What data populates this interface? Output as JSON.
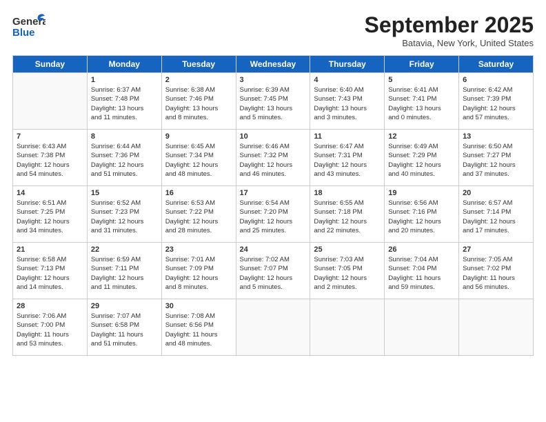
{
  "header": {
    "logo_general": "General",
    "logo_blue": "Blue",
    "title": "September 2025",
    "location": "Batavia, New York, United States"
  },
  "days_of_week": [
    "Sunday",
    "Monday",
    "Tuesday",
    "Wednesday",
    "Thursday",
    "Friday",
    "Saturday"
  ],
  "weeks": [
    [
      {
        "day": "",
        "info": ""
      },
      {
        "day": "1",
        "info": "Sunrise: 6:37 AM\nSunset: 7:48 PM\nDaylight: 13 hours\nand 11 minutes."
      },
      {
        "day": "2",
        "info": "Sunrise: 6:38 AM\nSunset: 7:46 PM\nDaylight: 13 hours\nand 8 minutes."
      },
      {
        "day": "3",
        "info": "Sunrise: 6:39 AM\nSunset: 7:45 PM\nDaylight: 13 hours\nand 5 minutes."
      },
      {
        "day": "4",
        "info": "Sunrise: 6:40 AM\nSunset: 7:43 PM\nDaylight: 13 hours\nand 3 minutes."
      },
      {
        "day": "5",
        "info": "Sunrise: 6:41 AM\nSunset: 7:41 PM\nDaylight: 13 hours\nand 0 minutes."
      },
      {
        "day": "6",
        "info": "Sunrise: 6:42 AM\nSunset: 7:39 PM\nDaylight: 12 hours\nand 57 minutes."
      }
    ],
    [
      {
        "day": "7",
        "info": "Sunrise: 6:43 AM\nSunset: 7:38 PM\nDaylight: 12 hours\nand 54 minutes."
      },
      {
        "day": "8",
        "info": "Sunrise: 6:44 AM\nSunset: 7:36 PM\nDaylight: 12 hours\nand 51 minutes."
      },
      {
        "day": "9",
        "info": "Sunrise: 6:45 AM\nSunset: 7:34 PM\nDaylight: 12 hours\nand 48 minutes."
      },
      {
        "day": "10",
        "info": "Sunrise: 6:46 AM\nSunset: 7:32 PM\nDaylight: 12 hours\nand 46 minutes."
      },
      {
        "day": "11",
        "info": "Sunrise: 6:47 AM\nSunset: 7:31 PM\nDaylight: 12 hours\nand 43 minutes."
      },
      {
        "day": "12",
        "info": "Sunrise: 6:49 AM\nSunset: 7:29 PM\nDaylight: 12 hours\nand 40 minutes."
      },
      {
        "day": "13",
        "info": "Sunrise: 6:50 AM\nSunset: 7:27 PM\nDaylight: 12 hours\nand 37 minutes."
      }
    ],
    [
      {
        "day": "14",
        "info": "Sunrise: 6:51 AM\nSunset: 7:25 PM\nDaylight: 12 hours\nand 34 minutes."
      },
      {
        "day": "15",
        "info": "Sunrise: 6:52 AM\nSunset: 7:23 PM\nDaylight: 12 hours\nand 31 minutes."
      },
      {
        "day": "16",
        "info": "Sunrise: 6:53 AM\nSunset: 7:22 PM\nDaylight: 12 hours\nand 28 minutes."
      },
      {
        "day": "17",
        "info": "Sunrise: 6:54 AM\nSunset: 7:20 PM\nDaylight: 12 hours\nand 25 minutes."
      },
      {
        "day": "18",
        "info": "Sunrise: 6:55 AM\nSunset: 7:18 PM\nDaylight: 12 hours\nand 22 minutes."
      },
      {
        "day": "19",
        "info": "Sunrise: 6:56 AM\nSunset: 7:16 PM\nDaylight: 12 hours\nand 20 minutes."
      },
      {
        "day": "20",
        "info": "Sunrise: 6:57 AM\nSunset: 7:14 PM\nDaylight: 12 hours\nand 17 minutes."
      }
    ],
    [
      {
        "day": "21",
        "info": "Sunrise: 6:58 AM\nSunset: 7:13 PM\nDaylight: 12 hours\nand 14 minutes."
      },
      {
        "day": "22",
        "info": "Sunrise: 6:59 AM\nSunset: 7:11 PM\nDaylight: 12 hours\nand 11 minutes."
      },
      {
        "day": "23",
        "info": "Sunrise: 7:01 AM\nSunset: 7:09 PM\nDaylight: 12 hours\nand 8 minutes."
      },
      {
        "day": "24",
        "info": "Sunrise: 7:02 AM\nSunset: 7:07 PM\nDaylight: 12 hours\nand 5 minutes."
      },
      {
        "day": "25",
        "info": "Sunrise: 7:03 AM\nSunset: 7:05 PM\nDaylight: 12 hours\nand 2 minutes."
      },
      {
        "day": "26",
        "info": "Sunrise: 7:04 AM\nSunset: 7:04 PM\nDaylight: 11 hours\nand 59 minutes."
      },
      {
        "day": "27",
        "info": "Sunrise: 7:05 AM\nSunset: 7:02 PM\nDaylight: 11 hours\nand 56 minutes."
      }
    ],
    [
      {
        "day": "28",
        "info": "Sunrise: 7:06 AM\nSunset: 7:00 PM\nDaylight: 11 hours\nand 53 minutes."
      },
      {
        "day": "29",
        "info": "Sunrise: 7:07 AM\nSunset: 6:58 PM\nDaylight: 11 hours\nand 51 minutes."
      },
      {
        "day": "30",
        "info": "Sunrise: 7:08 AM\nSunset: 6:56 PM\nDaylight: 11 hours\nand 48 minutes."
      },
      {
        "day": "",
        "info": ""
      },
      {
        "day": "",
        "info": ""
      },
      {
        "day": "",
        "info": ""
      },
      {
        "day": "",
        "info": ""
      }
    ]
  ]
}
